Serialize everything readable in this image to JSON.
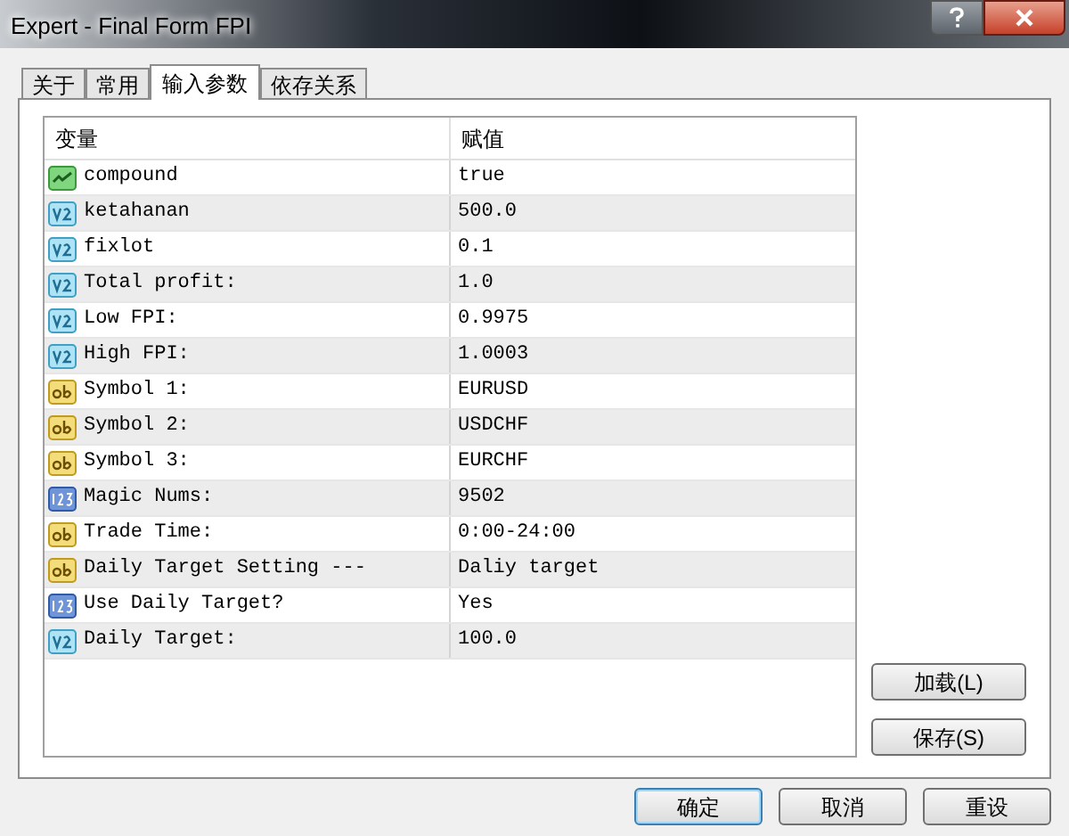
{
  "window": {
    "title": "Expert - Final Form FPI"
  },
  "tabs": [
    {
      "label": "关于",
      "selected": false
    },
    {
      "label": "常用",
      "selected": false
    },
    {
      "label": "输入参数",
      "selected": true
    },
    {
      "label": "依存关系",
      "selected": false
    }
  ],
  "table": {
    "columns": [
      "变量",
      "赋值"
    ],
    "rows": [
      {
        "kind": "bool",
        "name": "compound",
        "value": "true"
      },
      {
        "kind": "double",
        "name": "ketahanan",
        "value": "500.0"
      },
      {
        "kind": "double",
        "name": "fixlot",
        "value": "0.1"
      },
      {
        "kind": "double",
        "name": "Total profit:",
        "value": "1.0"
      },
      {
        "kind": "double",
        "name": "Low FPI:",
        "value": "0.9975"
      },
      {
        "kind": "double",
        "name": "High FPI:",
        "value": "1.0003"
      },
      {
        "kind": "string",
        "name": "Symbol 1:",
        "value": "EURUSD"
      },
      {
        "kind": "string",
        "name": "Symbol 2:",
        "value": "USDCHF"
      },
      {
        "kind": "string",
        "name": "Symbol 3:",
        "value": "EURCHF"
      },
      {
        "kind": "int",
        "name": "Magic Nums:",
        "value": "9502"
      },
      {
        "kind": "string",
        "name": "Trade Time:",
        "value": "0:00-24:00"
      },
      {
        "kind": "string",
        "name": "Daily Target Setting ---",
        "value": "Daliy target"
      },
      {
        "kind": "int",
        "name": "Use Daily Target?",
        "value": "Yes"
      },
      {
        "kind": "double",
        "name": "Daily Target:",
        "value": "100.0"
      }
    ]
  },
  "side_buttons": [
    "加载(L)",
    "保存(S)"
  ],
  "buttons": [
    "确定",
    "取消",
    "重设"
  ]
}
